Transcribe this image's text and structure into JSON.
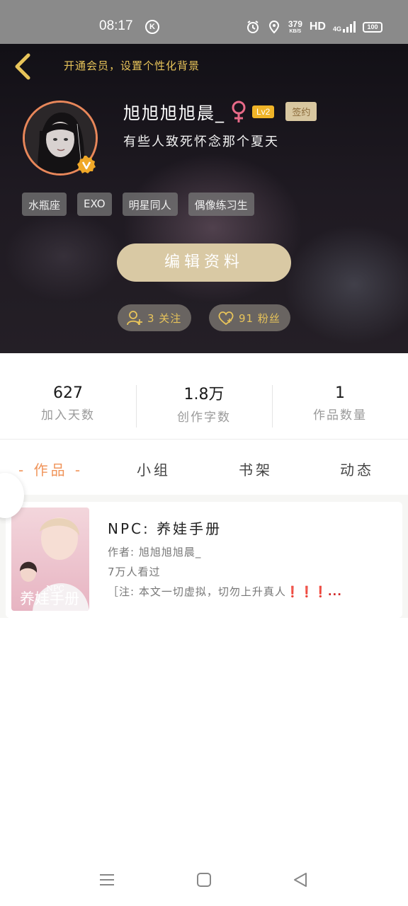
{
  "status_bar": {
    "time": "08:17",
    "k_badge": "K",
    "speed_value": "379",
    "speed_unit": "KB/S",
    "hd": "HD",
    "network": "4G",
    "battery": "100"
  },
  "header": {
    "vip_prompt": "开通会员，设置个性化背景",
    "username": "旭旭旭旭晨_",
    "level": "Lv2",
    "sign_badge": "签约",
    "bio": "有些人致死怀念那个夏天",
    "tags": [
      "水瓶座",
      "EXO",
      "明星同人",
      "偶像练习生"
    ],
    "edit_button": "编辑资料",
    "following_label": "3 关注",
    "followers_label": "91 粉丝"
  },
  "stats": [
    {
      "value": "627",
      "label": "加入天数"
    },
    {
      "value": "1.8万",
      "label": "创作字数"
    },
    {
      "value": "1",
      "label": "作品数量"
    }
  ],
  "tabs": [
    "- 作品 -",
    "小组",
    "书架",
    "动态"
  ],
  "works": [
    {
      "title": "NPC: 养娃手册",
      "author": "作者: 旭旭旭旭晨_",
      "views": "7万人看过",
      "desc_prefix": "［注: 本文一切虚拟，切勿上升真人",
      "desc_bangs": "❗❗❗...",
      "cover_text": "养娃手册",
      "cover_sub": "NPC"
    }
  ],
  "colors": {
    "accent_gold": "#e8c45a",
    "active_tab": "#f0945a",
    "edit_button": "#d9c9a4",
    "level_badge": "#f0b428"
  }
}
